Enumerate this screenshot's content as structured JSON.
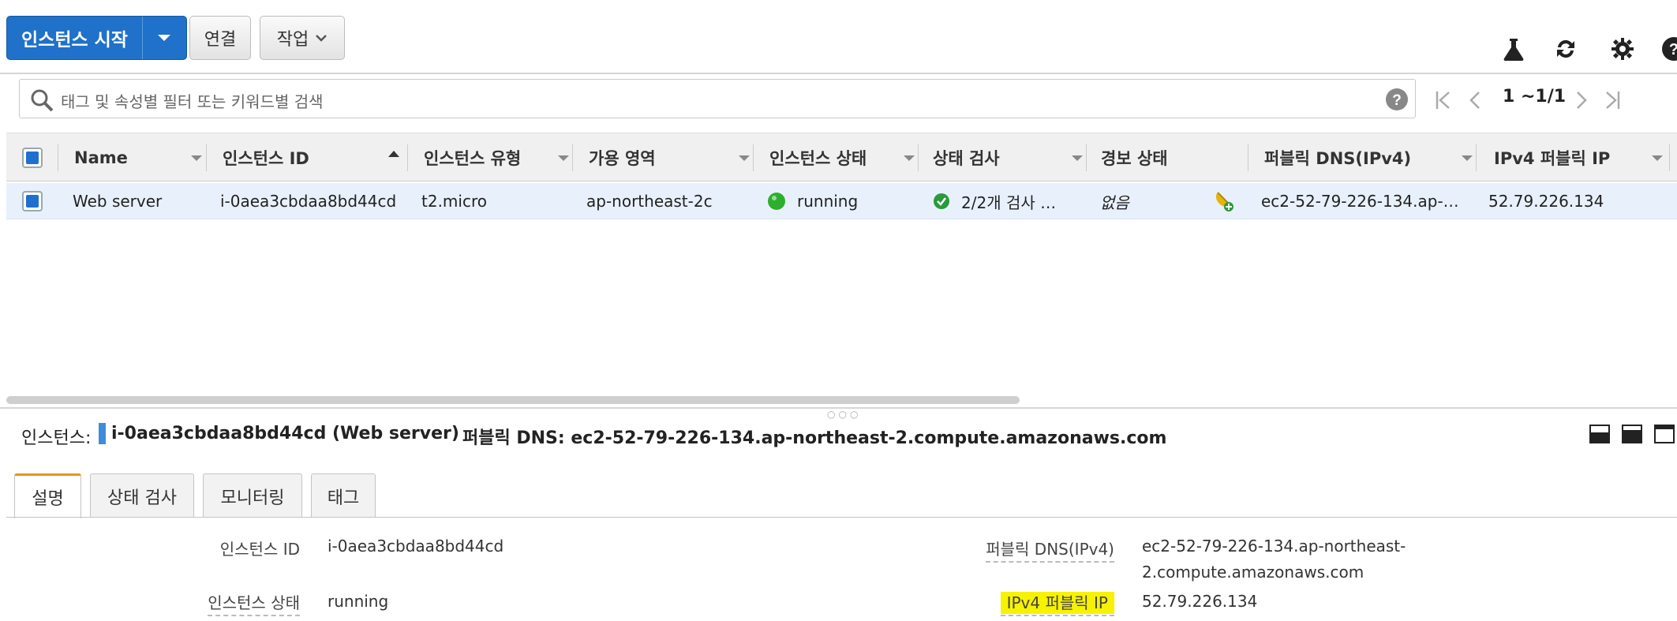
{
  "toolbar": {
    "launch_label": "인스턴스 시작",
    "connect_label": "연결",
    "actions_label": "작업"
  },
  "search": {
    "placeholder": "태그 및 속성별 필터 또는 키워드별 검색"
  },
  "pagination": {
    "range": "1 ~1/1"
  },
  "table": {
    "columns": [
      "Name",
      "인스턴스 ID",
      "인스턴스 유형",
      "가용 영역",
      "인스턴스 상태",
      "상태 검사",
      "경보 상태",
      "퍼블릭 DNS(IPv4)",
      "IPv4 퍼블릭 IP"
    ],
    "rows": [
      {
        "name": "Web server",
        "instance_id": "i-0aea3cbdaa8bd44cd",
        "type": "t2.micro",
        "zone": "ap-northeast-2c",
        "state": "running",
        "status_check": "2/2개 검사 …",
        "alarm": "없음",
        "dns": "ec2-52-79-226-134.ap-…",
        "ip": "52.79.226.134"
      }
    ]
  },
  "detail": {
    "instance_label": "인스턴스:",
    "instance_value": "i-0aea3cbdaa8bd44cd (Web server)",
    "dns_header": "퍼블릭 DNS: ec2-52-79-226-134.ap-northeast-2.compute.amazonaws.com",
    "tabs": [
      "설명",
      "상태 검사",
      "모니터링",
      "태그"
    ],
    "fields": {
      "instance_id_label": "인스턴스 ID",
      "instance_id_value": "i-0aea3cbdaa8bd44cd",
      "state_label": "인스턴스 상태",
      "state_value": "running",
      "dns_label": "퍼블릭 DNS(IPv4)",
      "dns_value_1": "ec2-52-79-226-134.ap-northeast-",
      "dns_value_2": "2.compute.amazonaws.com",
      "ip_label": "IPv4 퍼블릭 IP",
      "ip_value": "52.79.226.134"
    }
  },
  "colors": {
    "primary": "#1f71c9",
    "row_selected": "#e8f1fb",
    "tab_active": "#e8950f",
    "highlight": "#f7f200",
    "running": "#2eae2e"
  }
}
